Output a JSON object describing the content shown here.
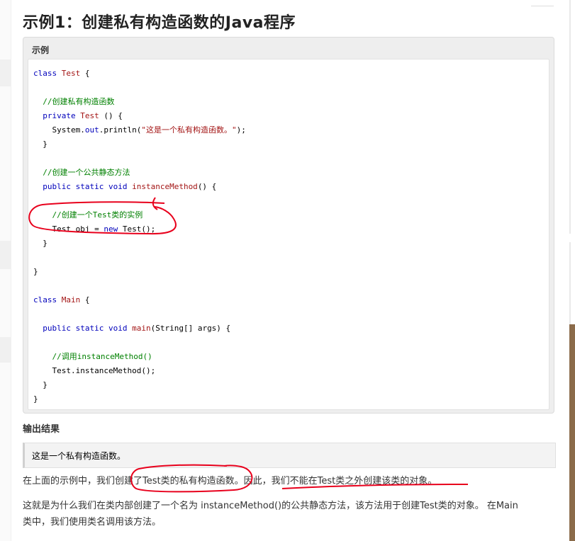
{
  "page": {
    "title": "示例1：创建私有构造函数的Java程序"
  },
  "example": {
    "label": "示例",
    "code_lines": [
      [
        {
          "t": "class ",
          "c": "kw"
        },
        {
          "t": "Test",
          "c": "cls"
        },
        {
          "t": " {",
          "c": ""
        }
      ],
      [],
      [
        {
          "t": "  //创建私有构造函数",
          "c": "cmt"
        }
      ],
      [
        {
          "t": "  ",
          "c": ""
        },
        {
          "t": "private ",
          "c": "kw"
        },
        {
          "t": "Test",
          "c": "cls"
        },
        {
          "t": " () {",
          "c": ""
        }
      ],
      [
        {
          "t": "    System.",
          "c": ""
        },
        {
          "t": "out",
          "c": "out"
        },
        {
          "t": ".println(",
          "c": ""
        },
        {
          "t": "\"这是一个私有构造函数。\"",
          "c": "str"
        },
        {
          "t": ");",
          "c": ""
        }
      ],
      [
        {
          "t": "  }",
          "c": ""
        }
      ],
      [],
      [
        {
          "t": "  //创建一个公共静态方法",
          "c": "cmt"
        }
      ],
      [
        {
          "t": "  ",
          "c": ""
        },
        {
          "t": "public ",
          "c": "kw"
        },
        {
          "t": "static ",
          "c": "kw"
        },
        {
          "t": "void ",
          "c": "kw"
        },
        {
          "t": "instanceMethod",
          "c": "cls"
        },
        {
          "t": "() {",
          "c": ""
        }
      ],
      [],
      [
        {
          "t": "    //创建一个Test类的实例",
          "c": "cmt"
        }
      ],
      [
        {
          "t": "    Test obj = ",
          "c": ""
        },
        {
          "t": "new ",
          "c": "kw"
        },
        {
          "t": "Test();",
          "c": ""
        }
      ],
      [
        {
          "t": "  }",
          "c": ""
        }
      ],
      [],
      [
        {
          "t": "}",
          "c": ""
        }
      ],
      [],
      [
        {
          "t": "class ",
          "c": "kw"
        },
        {
          "t": "Main",
          "c": "cls"
        },
        {
          "t": " {",
          "c": ""
        }
      ],
      [],
      [
        {
          "t": "  ",
          "c": ""
        },
        {
          "t": "public ",
          "c": "kw"
        },
        {
          "t": "static ",
          "c": "kw"
        },
        {
          "t": "void ",
          "c": "kw"
        },
        {
          "t": "main",
          "c": "cls"
        },
        {
          "t": "(String[] args) {",
          "c": ""
        }
      ],
      [],
      [
        {
          "t": "    //调用instanceMethod()",
          "c": "cmt"
        }
      ],
      [
        {
          "t": "    Test.instanceMethod();",
          "c": ""
        }
      ],
      [
        {
          "t": "  }",
          "c": ""
        }
      ],
      [
        {
          "t": "}",
          "c": ""
        }
      ]
    ]
  },
  "output": {
    "heading": "输出结果",
    "text": "这是一个私有构造函数。"
  },
  "paragraphs": {
    "p1": "在上面的示例中，我们创建了Test类的私有构造函数。因此，我们不能在Test类之外创建该类的对象。",
    "p2_line1": "这就是为什么我们在类内部创建了一个名为 instanceMethod()的公共静态方法，该方法用于创建Test类的对象。 在Main",
    "p2_line2": "类中，我们使用类名调用该方法。"
  },
  "colors": {
    "annotation": "#e8001c",
    "keyword": "#0000bb",
    "comment": "#008000",
    "class_name": "#a31515"
  }
}
